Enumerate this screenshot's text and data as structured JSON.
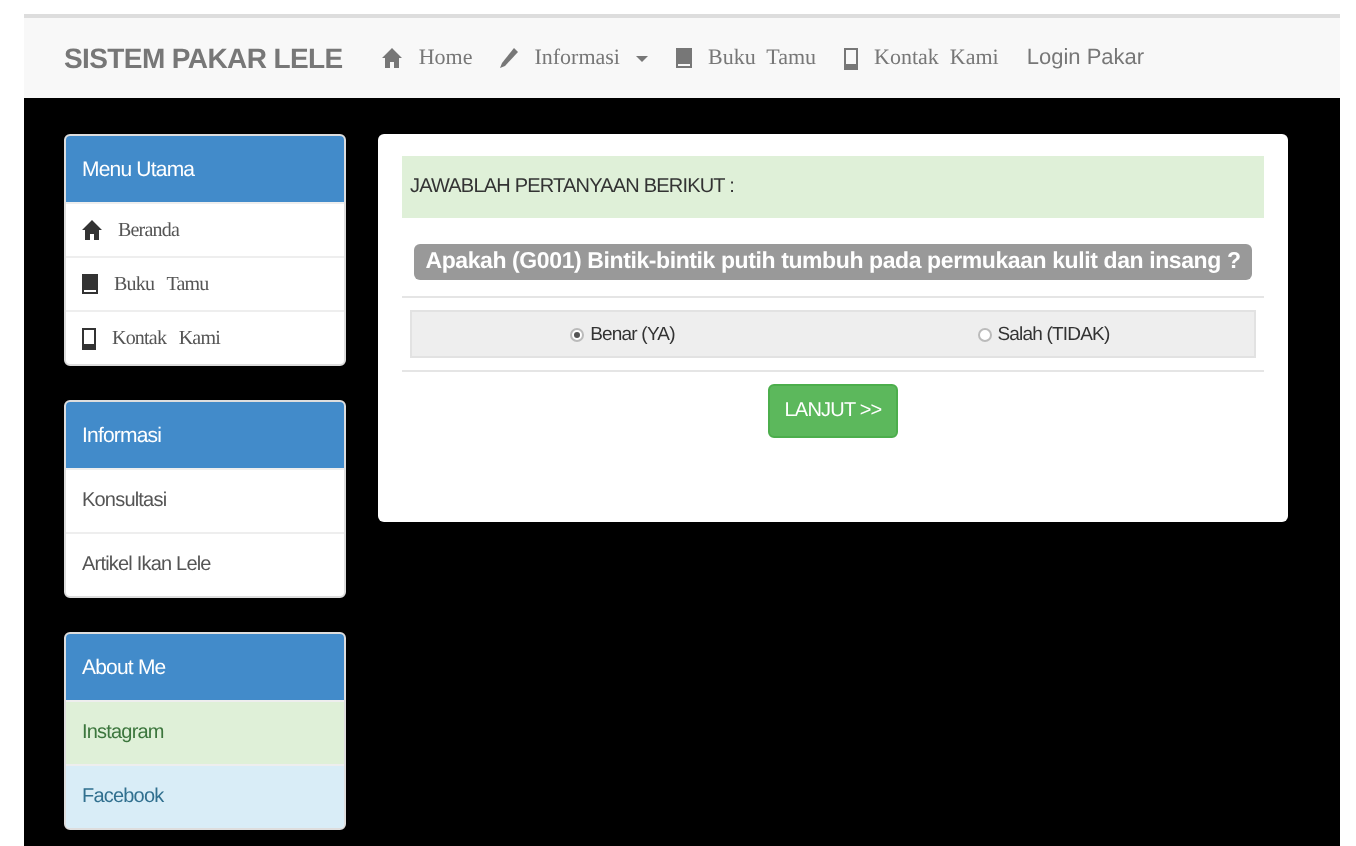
{
  "navbar": {
    "brand": "SISTEM PAKAR LELE",
    "items": [
      {
        "label": "Home",
        "kind": "home",
        "dropdown": false
      },
      {
        "label": "Informasi",
        "kind": "pencil",
        "dropdown": true
      },
      {
        "label": "Buku  Tamu",
        "kind": "book",
        "dropdown": false
      },
      {
        "label": "Kontak  Kami",
        "kind": "phone",
        "dropdown": false
      },
      {
        "label": "Login Pakar",
        "kind": "plain",
        "dropdown": false
      }
    ]
  },
  "sidebar": [
    {
      "title": "Menu Utama",
      "items": [
        {
          "label": "Beranda",
          "kind": "home"
        },
        {
          "label": "Buku   Tamu",
          "kind": "book"
        },
        {
          "label": "Kontak   Kami",
          "kind": "phone"
        }
      ]
    },
    {
      "title": "Informasi",
      "items": [
        {
          "label": "Konsultasi",
          "kind": "plain"
        },
        {
          "label": "Artikel Ikan Lele",
          "kind": "plain"
        }
      ]
    },
    {
      "title": "About Me",
      "items": [
        {
          "label": "Instagram",
          "kind": "plain",
          "color": "#dff0d8"
        },
        {
          "label": "Facebook",
          "kind": "plain",
          "color": "#d9edf7"
        }
      ]
    }
  ],
  "question": {
    "header": "JAWABLAH PERTANYAAN BERIKUT :",
    "text": "Apakah (G001) Bintik-bintik putih tumbuh pada permukaan kulit dan insang ?",
    "options": [
      {
        "label": "Benar (YA)",
        "selected": true
      },
      {
        "label": "Salah (TIDAK)",
        "selected": false
      }
    ],
    "button": "LANJUT >>"
  }
}
